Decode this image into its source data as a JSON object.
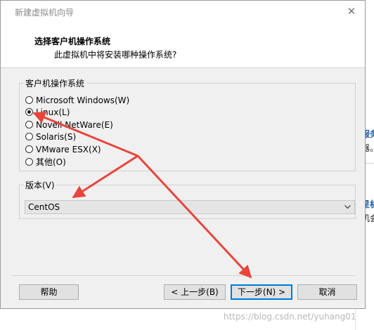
{
  "window": {
    "title": "新建虚拟机向导",
    "close_symbol": "✕"
  },
  "header": {
    "title": "选择客户机操作系统",
    "subtitle": "此虚拟机中将安装哪种操作系统?"
  },
  "os_group": {
    "legend": "客户机操作系统",
    "options": [
      {
        "label": "Microsoft Windows(W)",
        "checked": false
      },
      {
        "label": "Linux(L)",
        "checked": true
      },
      {
        "label": "Novell NetWare(E)",
        "checked": false
      },
      {
        "label": "Solaris(S)",
        "checked": false
      },
      {
        "label": "VMware ESX(X)",
        "checked": false
      },
      {
        "label": "其他(O)",
        "checked": false
      }
    ]
  },
  "version_group": {
    "legend": "版本(V)",
    "selected": "CentOS"
  },
  "buttons": {
    "help": "帮助",
    "back": "< 上一步(B)",
    "next": "下一步(N) >",
    "cancel": "取消"
  },
  "background": {
    "fragments": [
      "服务",
      "器。",
      "星机",
      "机会"
    ]
  },
  "watermark": "https://blog.csdn.net/yuhang01",
  "annotation_color": "#e8453c"
}
